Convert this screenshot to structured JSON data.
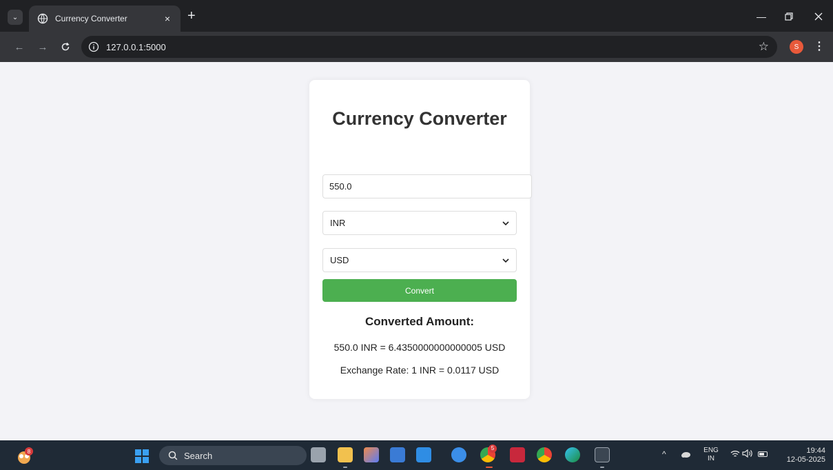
{
  "browser": {
    "tab_title": "Currency Converter",
    "tab_close": "×",
    "new_tab": "+",
    "url": "127.0.0.1:5000",
    "profile_initial": "S"
  },
  "page": {
    "heading": "Currency Converter",
    "amount_value": "550.0",
    "from_currency": "INR",
    "to_currency": "USD",
    "convert_label": "Convert",
    "result_title": "Converted Amount:",
    "result_line": "550.0 INR = 6.4350000000000005 USD",
    "rate_line": "Exchange Rate: 1 INR = 0.0117 USD",
    "convert_color": "#4caf50"
  },
  "taskbar": {
    "search_placeholder": "Search",
    "widgets_badge": "8",
    "chrome_badge": "5",
    "lang_top": "ENG",
    "lang_bottom": "IN",
    "time": "19:44",
    "date": "12-05-2025"
  }
}
